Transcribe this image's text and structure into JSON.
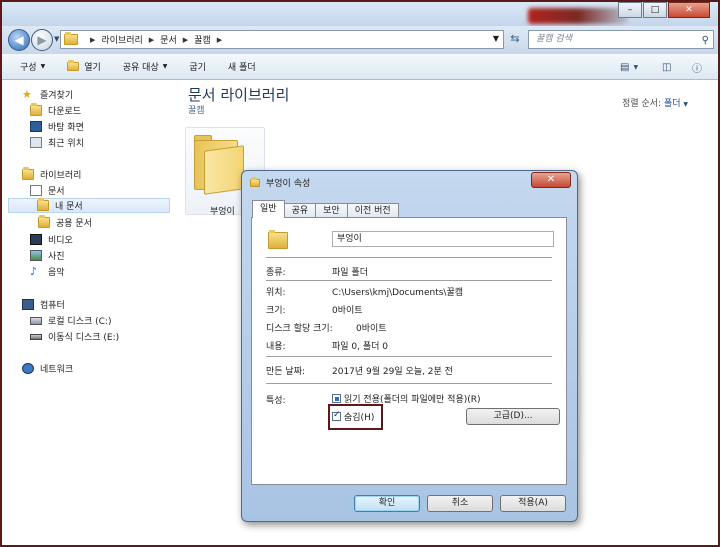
{
  "search": {
    "placeholder": "꿀캠 검색"
  },
  "breadcrumb": [
    "라이브러리",
    "문서",
    "꿀캠"
  ],
  "toolbar": {
    "organize": "구성",
    "open": "열기",
    "share": "공유 대상",
    "burn": "굽기",
    "new_folder": "새 폴더"
  },
  "sidebar": {
    "favorites": "즐겨찾기",
    "fav_items": [
      "다운로드",
      "바탕 화면",
      "최근 위치"
    ],
    "libraries": "라이브러리",
    "documents": "문서",
    "my_documents": "내 문서",
    "public_documents": "공용 문서",
    "video": "비디오",
    "pictures": "사진",
    "music": "음악",
    "computer": "컴퓨터",
    "local_disk": "로컬 디스크 (C:)",
    "removable": "이동식 디스크 (E:)",
    "network": "네트워크"
  },
  "library": {
    "title": "문서 라이브러리",
    "subtitle": "꿀캠",
    "sort_label": "정렬 순서:",
    "sort_value": "폴더",
    "item": "부엉이"
  },
  "dialog": {
    "title": "부엉이 속성",
    "tabs": [
      "일반",
      "공유",
      "보안",
      "이전 버전"
    ],
    "name": "부엉이",
    "type_label": "종류:",
    "type_value": "파일 폴더",
    "location_label": "위치:",
    "location_value": "C:\\Users\\kmj\\Documents\\꿀캠",
    "size_label": "크기:",
    "size_value": "0바이트",
    "disk_label": "디스크 할당 크기:",
    "disk_value": "0바이트",
    "contents_label": "내용:",
    "contents_value": "파일 0, 폴더 0",
    "created_label": "만든 날짜:",
    "created_value": "2017년 9월 29일 오늘, 2분 전",
    "attributes_label": "특성:",
    "readonly": "읽기 전용(폴더의 파일에만 적용)(R)",
    "hidden": "숨김(H)",
    "advanced": "고급(D)...",
    "ok": "확인",
    "cancel": "취소",
    "apply": "적용(A)",
    "hidden_checked": true
  }
}
